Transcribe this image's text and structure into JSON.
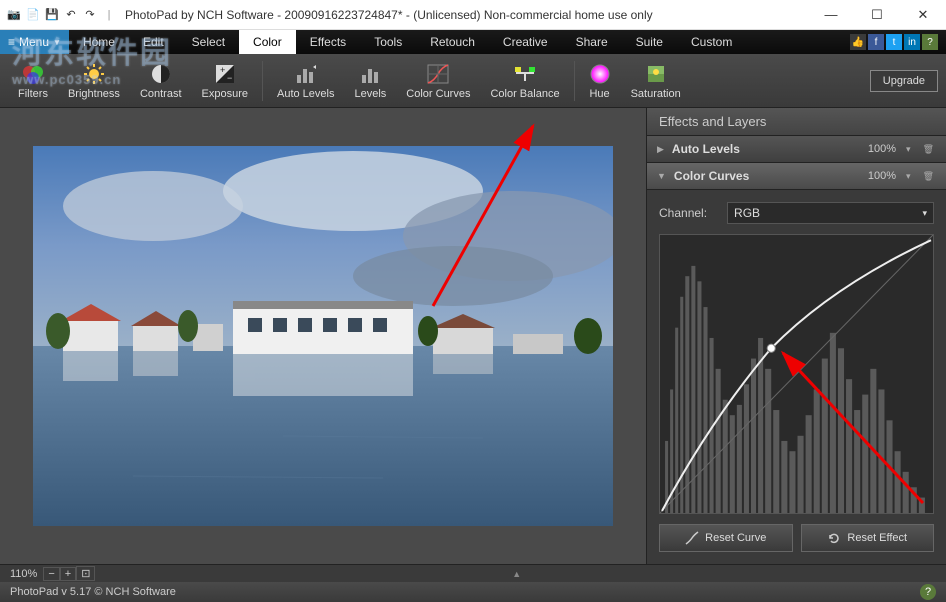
{
  "window": {
    "title": "PhotoPad by NCH Software - 20090916223724847* - (Unlicensed) Non-commercial home use only"
  },
  "menu": {
    "button": "Menu",
    "items": [
      "Home",
      "Edit",
      "Select",
      "Color",
      "Effects",
      "Tools",
      "Retouch",
      "Creative",
      "Share",
      "Suite",
      "Custom"
    ],
    "active": "Color"
  },
  "toolbar": {
    "filters": "Filters",
    "brightness": "Brightness",
    "contrast": "Contrast",
    "exposure": "Exposure",
    "auto_levels": "Auto Levels",
    "levels": "Levels",
    "color_curves": "Color Curves",
    "color_balance": "Color Balance",
    "hue": "Hue",
    "saturation": "Saturation",
    "upgrade": "Upgrade"
  },
  "panel": {
    "title": "Effects and Layers",
    "layers": [
      {
        "name": "Auto Levels",
        "pct": "100%"
      },
      {
        "name": "Color Curves",
        "pct": "100%"
      }
    ],
    "channel_label": "Channel:",
    "channel_value": "RGB",
    "reset_curve": "Reset Curve",
    "reset_effect": "Reset Effect"
  },
  "zoom": "110%",
  "status": "PhotoPad v 5.17 © NCH Software",
  "watermark": {
    "big": "河东软件园",
    "small": "www.pc0359.cn"
  }
}
